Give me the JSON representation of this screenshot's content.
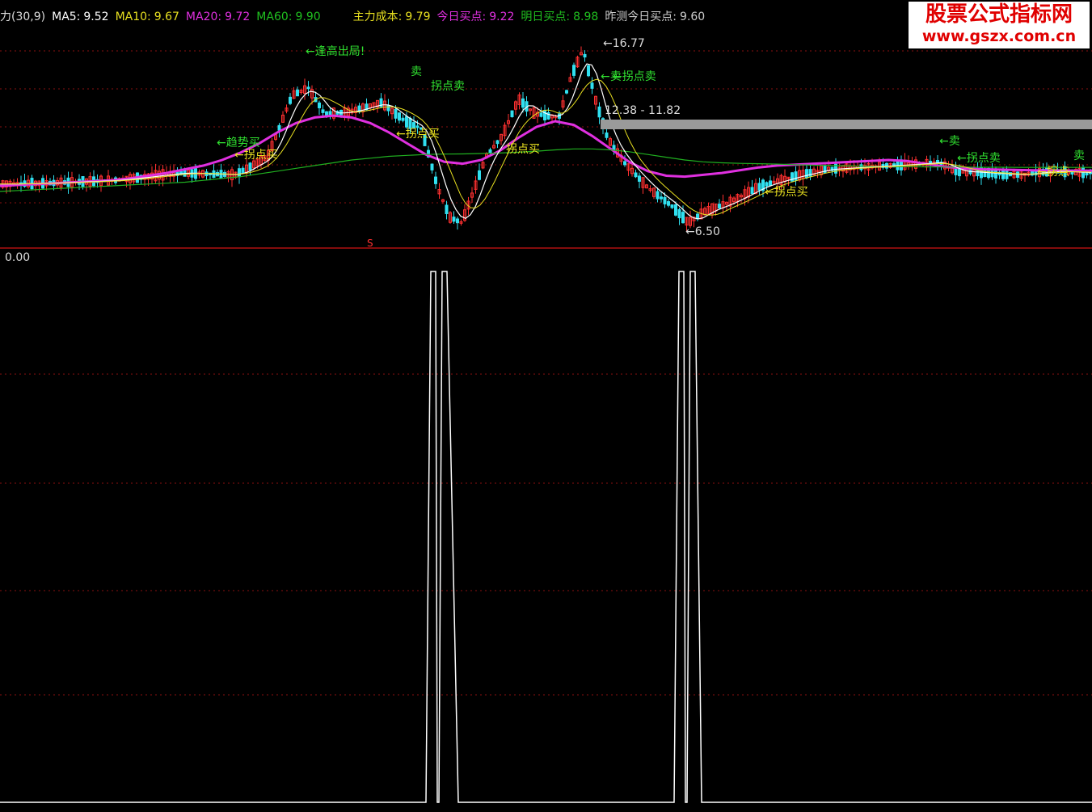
{
  "colors": {
    "background": "#000000",
    "grid": "#8a1010",
    "divider": "#b01010",
    "ma5": "#ffffff",
    "ma10": "#e8e020",
    "ma20": "#e030e0",
    "ma60": "#20b020",
    "cost": "#e8e020",
    "today_buy": "#e030e0",
    "tomorrow_buy": "#20c020",
    "yest_buy": "#cccccc",
    "candle_up": "#ff3030",
    "candle_down": "#30e0f0",
    "signal_green": "#30e030",
    "signal_yellow": "#e8e020",
    "resistance_bar": "#9a9a9a",
    "sub_line": "#ffffff"
  },
  "header": {
    "indicator": "力(30,9)",
    "ma5_label": "MA5:",
    "ma5_value": "9.52",
    "ma10_label": "MA10:",
    "ma10_value": "9.67",
    "ma20_label": "MA20:",
    "ma20_value": "9.72",
    "ma60_label": "MA60:",
    "ma60_value": "9.90",
    "cost_label": "主力成本:",
    "cost_value": "9.79",
    "today_label": "今日买点:",
    "today_value": "9.22",
    "tomorrow_label": "明日买点:",
    "tomorrow_value": "8.98",
    "yest_label": "昨测今日买点:",
    "yest_value": "9.60"
  },
  "watermark": {
    "line1": "股票公式指标网",
    "line2": "www.gszx.com.cn"
  },
  "annotations": {
    "high_price": "16.77",
    "low_price": "6.50",
    "range": "12.38 - 11.82",
    "escape_high": "←逢高出局!",
    "sell_1": "←卖",
    "sell_2": "←卖",
    "sell_3": "卖",
    "turn_sell_1": "拐点卖",
    "turn_sell_2": "←拐点卖",
    "turn_sell_3": "←拐点卖",
    "turn_buy_1": "←拐点买",
    "turn_buy_2": "←拐点买",
    "turn_buy_3": "拐点买",
    "turn_buy_4": "←拐点买",
    "buy_1": "←趋势买",
    "marker_s": "S",
    "tail_1": "←拐点",
    "tail_2": "卖"
  },
  "sub_panel": {
    "value_label": "0.00"
  },
  "chart_data": [
    {
      "type": "line",
      "title": "",
      "series": [
        {
          "name": "MA20",
          "values": [
            8.9,
            8.95,
            9.0,
            9.05,
            9.1,
            9.15,
            9.2,
            9.3,
            9.45,
            9.6,
            9.8,
            10.0,
            10.3,
            10.7,
            11.2,
            11.8,
            12.3,
            12.6,
            12.7,
            12.6,
            12.3,
            11.8,
            11.2,
            10.6,
            10.2,
            10.1,
            10.3,
            10.8,
            11.5,
            12.1,
            12.4,
            12.2,
            11.6,
            10.9,
            10.2,
            9.7,
            9.45,
            9.4,
            9.5,
            9.6,
            9.75,
            9.9,
            10.0,
            10.05,
            10.1,
            10.15,
            10.2,
            10.25,
            10.3,
            10.25,
            10.1,
            9.95,
            9.85,
            9.8,
            9.78,
            9.76,
            9.74,
            9.73,
            9.72,
            9.72
          ]
        },
        {
          "name": "MA60",
          "values": [
            8.6,
            8.65,
            8.7,
            8.75,
            8.8,
            8.85,
            8.9,
            8.95,
            9.0,
            9.05,
            9.1,
            9.2,
            9.3,
            9.4,
            9.55,
            9.7,
            9.85,
            10.0,
            10.15,
            10.3,
            10.4,
            10.5,
            10.55,
            10.6,
            10.62,
            10.63,
            10.65,
            10.68,
            10.72,
            10.78,
            10.85,
            10.9,
            10.9,
            10.85,
            10.75,
            10.6,
            10.45,
            10.3,
            10.2,
            10.15,
            10.12,
            10.1,
            10.08,
            10.05,
            10.02,
            10.0,
            9.98,
            9.96,
            9.95,
            9.94,
            9.93,
            9.92,
            9.92,
            9.91,
            9.91,
            9.9,
            9.9,
            9.9,
            9.9,
            9.9
          ]
        }
      ],
      "high": 16.77,
      "low": 6.5
    },
    {
      "type": "line",
      "title": "",
      "series": [
        {
          "name": "signal",
          "values": [
            0,
            0,
            0,
            0,
            0,
            0,
            0,
            0,
            0,
            0,
            0,
            0,
            0,
            0,
            0,
            0,
            0,
            0,
            0,
            0,
            0,
            0,
            0,
            0,
            0,
            0,
            1,
            0,
            1,
            0,
            0,
            0,
            0,
            0,
            0,
            0,
            0,
            0,
            0,
            0,
            0,
            0,
            1,
            1,
            0,
            0,
            0,
            0,
            0,
            0,
            0,
            0,
            0,
            0,
            0,
            0,
            0,
            0,
            0,
            0
          ]
        }
      ]
    }
  ]
}
